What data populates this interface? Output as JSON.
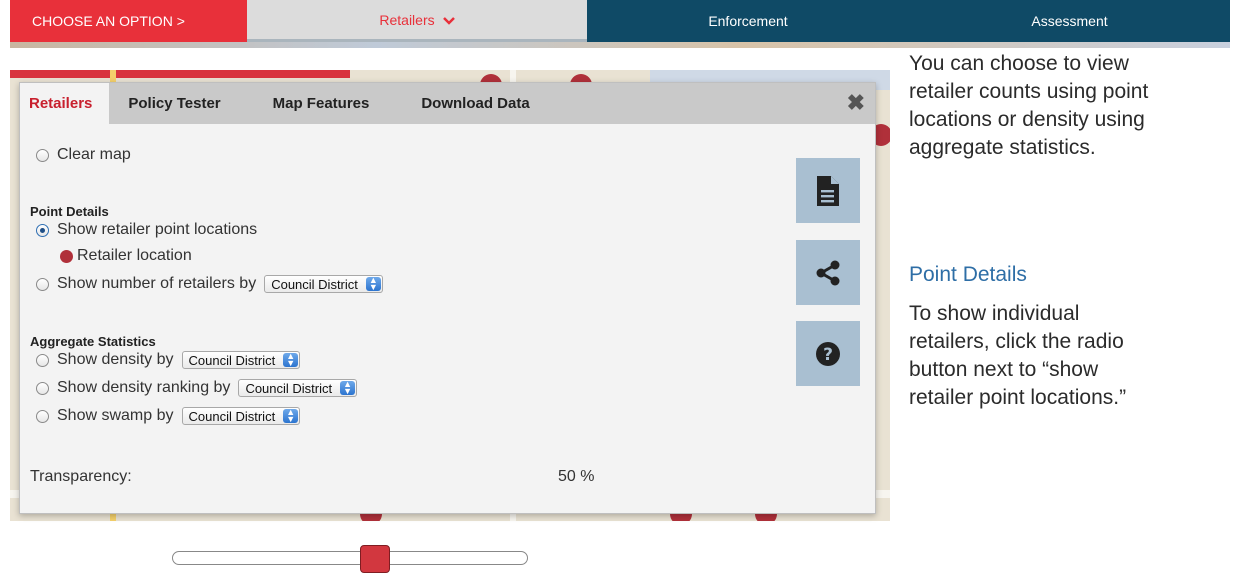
{
  "nav": {
    "choose": "CHOOSE AN OPTION >",
    "retailers": "Retailers",
    "enforcement": "Enforcement",
    "assessment": "Assessment"
  },
  "tabs": [
    "Retailers",
    "Policy Tester",
    "Map Features",
    "Download Data"
  ],
  "close_label": "✖",
  "panel": {
    "clear_map": "Clear map",
    "point_details_title": "Point Details",
    "show_points": "Show retailer point locations",
    "retailer_location": "Retailer location",
    "show_number": "Show number of retailers by",
    "aggregate_title": "Aggregate Statistics",
    "show_density": "Show density by",
    "show_density_ranking": "Show density ranking by",
    "show_swamp": "Show swamp by",
    "select_value": "Council District",
    "transparency_label": "Transparency:",
    "transparency_value": "50 %",
    "transparency": 0.5
  },
  "side_buttons": [
    "document-icon",
    "share-icon",
    "help-icon"
  ],
  "right": {
    "intro_lines": [
      "You can choose to view",
      "retailer counts using point",
      "locations or density using",
      "aggregate statistics."
    ],
    "heading": "Point Details",
    "detail_lines": [
      "To show individual",
      "retailers, click the radio",
      "button next to “show",
      "retailer point locations.”"
    ]
  },
  "colors": {
    "accent_red": "#e8303a",
    "nav_dark": "#0f4a66",
    "marker": "#b0303a",
    "heading_blue": "#2e6ea6"
  }
}
